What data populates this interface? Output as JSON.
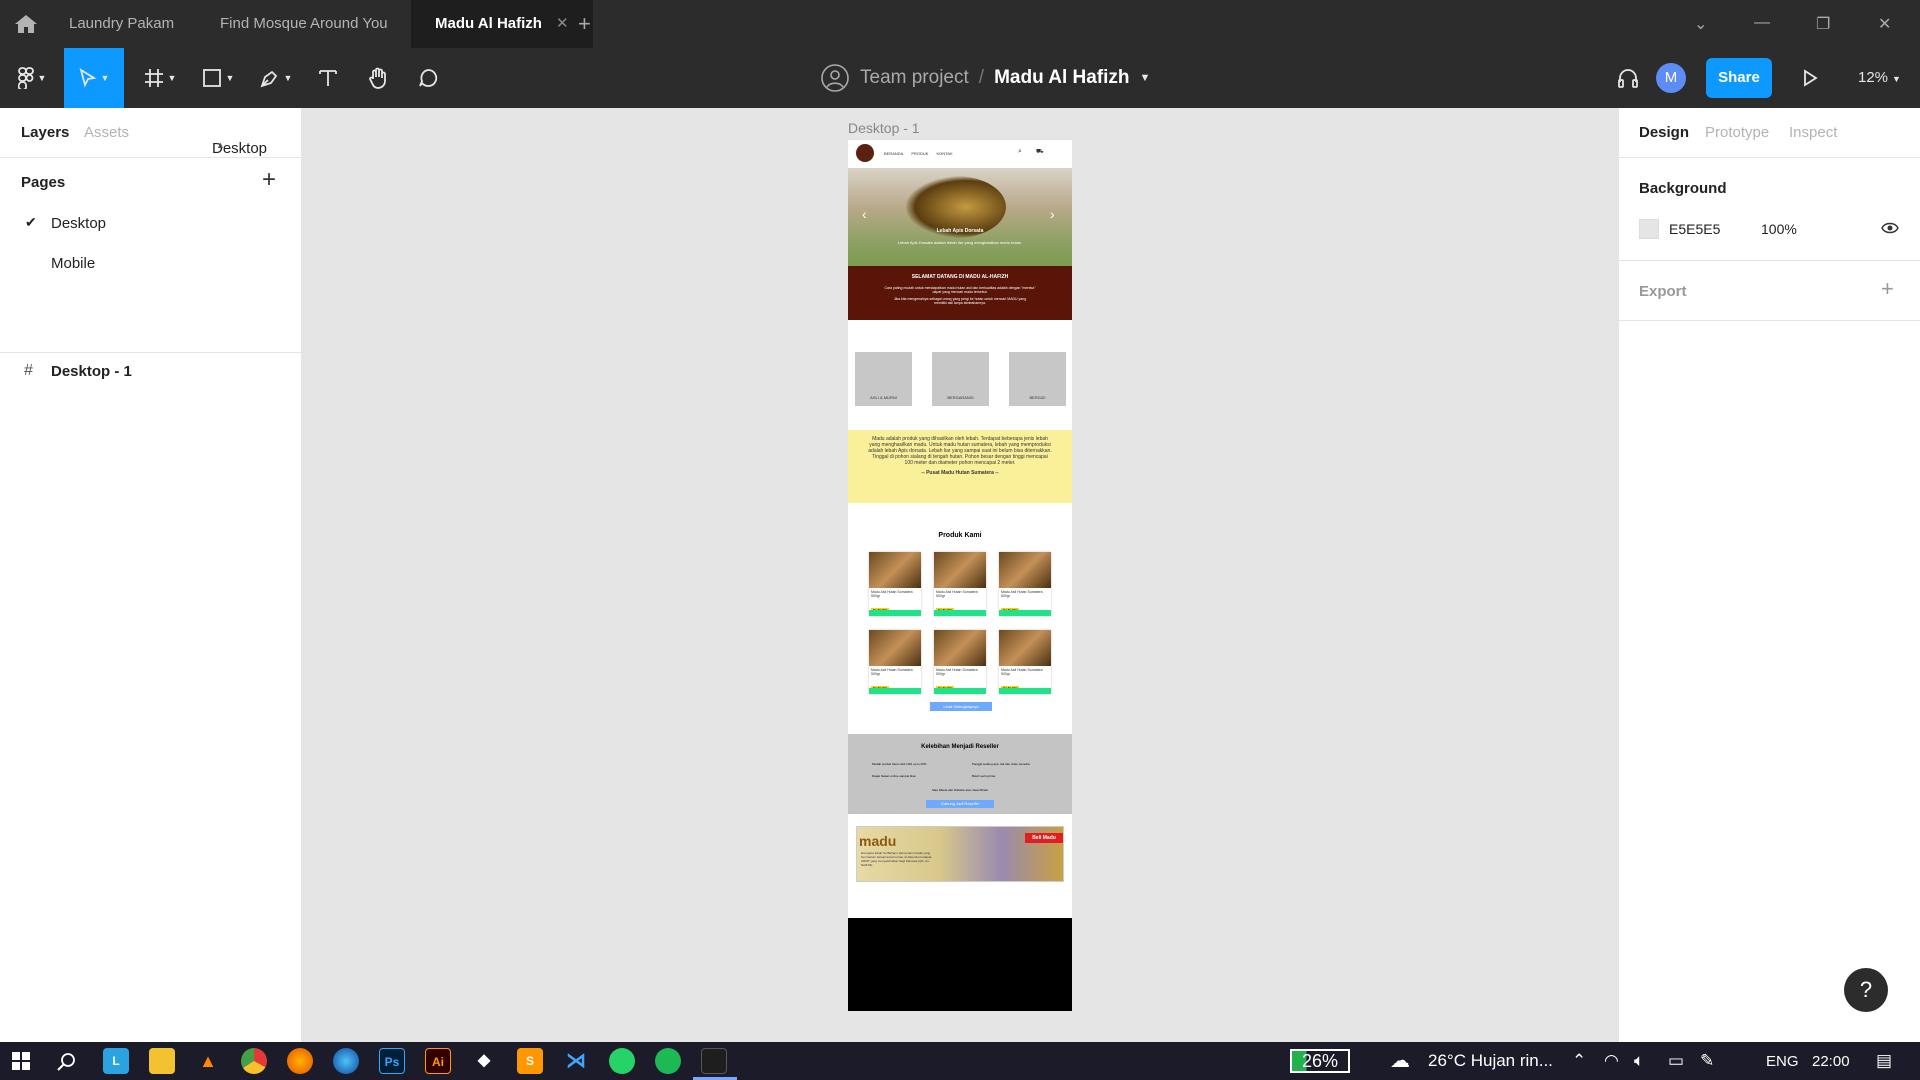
{
  "titlebar": {
    "tabs": [
      {
        "label": "Laundry Pakam"
      },
      {
        "label": "Find Mosque Around You"
      },
      {
        "label": "Madu Al Hafizh"
      }
    ]
  },
  "toolbar": {
    "team": "Team project",
    "separator": "/",
    "file_name": "Madu Al Hafizh",
    "avatar_initial": "M",
    "share_label": "Share",
    "zoom": "12%"
  },
  "left_panel": {
    "tabs": [
      "Layers",
      "Assets"
    ],
    "page_selector": "Desktop",
    "pages_heading": "Pages",
    "pages": [
      "Desktop",
      "Mobile"
    ],
    "layer": "Desktop - 1"
  },
  "right_panel": {
    "tabs": [
      "Design",
      "Prototype",
      "Inspect"
    ],
    "background_heading": "Background",
    "bg_hex": "E5E5E5",
    "bg_opacity": "100%",
    "export_heading": "Export"
  },
  "canvas": {
    "frame_label": "Desktop - 1",
    "nav_links": [
      "BERANDA",
      "PRODUK",
      "KONTAK"
    ],
    "hero_title": "Lebah Apis Dorsata",
    "hero_sub": "Lebah Apis Dorsata adalah lebah liar yang menghasilkan madu hutan.",
    "welcome_title": "SELAMAT DATANG DI MADU AL-HAFIZH",
    "welcome_text1": "Cara paling mudah untuk mendapatkan madu hutan asli dan berkualitas adalah dengan \"mereka\" dapat yang mencari madu tersebut.",
    "welcome_text2": "Jika kita mengenalnya sebagai orang yang pergi ke hutan untuk mencari MADU yang memiliki asli tanpa tambahannya.",
    "boxes": [
      "ASLI & MURNI",
      "BERGARANSI",
      "BERGIZI"
    ],
    "yellow_text": "Madu adalah produk yang dihasilkan oleh lebah. Terdapat beberapa jenis lebah yang menghasilkan madu. Untuk madu hutan sumatera, lebah yang memproduksi adalah lebah Apis dorsata. Lebah liar yang sampai saat ini belum bisa diternakkan. Tinggal di pohon sialang di tengah hutan. Pohon besar dengan tinggi mencapai 100 meter dan diameter pohon mencapai 2 meter.",
    "yellow_tag": "-- Pusat Madu Hutan Sumatera --",
    "products_heading": "Produk Kami",
    "product_name": "Madu Asli Hutan Sumatera 500gr",
    "product_price": "Rp 80.000",
    "see_all": "Lihat Selengkapnya",
    "reseller_heading": "Kelebihan Menjadi Reseller",
    "reseller_points": [
      "Mudah produk harus dari 10% up to 25%",
      "Panggil sedang apa, tak dan video tersedia",
      "Dapat hiasan online sampai bisa",
      "Boleh sering bisa"
    ],
    "reseller_note": "Mau Diketa dari Website atau Jasa Whats",
    "reseller_button": "Gabung Jadi Reseller",
    "banner_brand": "madu",
    "banner_button": "Beli Madu",
    "banner_text": "Dari gana lebah Su Bebann Hervernam limaiki yang bermaxtum bersama bermurnai, di dikemasi terdapat CRMT yang menyambutkan Sagi Manusia (QS. An-Nahl:69)"
  },
  "taskbar": {
    "battery": "26%",
    "weather": "26°C  Hujan rin...",
    "lang": "ENG",
    "time": "22:00"
  },
  "help_label": "?"
}
